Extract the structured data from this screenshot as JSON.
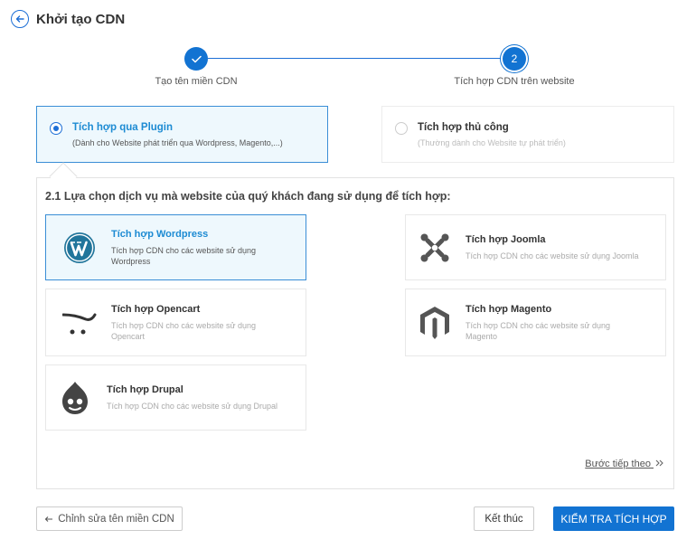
{
  "header": {
    "title": "Khởi tạo CDN"
  },
  "stepper": {
    "step1": {
      "label": "Tạo tên miền CDN",
      "icon": "check-icon"
    },
    "step2": {
      "number": "2",
      "label": "Tích hợp CDN trên website"
    }
  },
  "options": [
    {
      "title": "Tích hợp qua Plugin",
      "desc": "(Dành cho Website phát triển qua Wordpress, Magento,...)",
      "selected": true
    },
    {
      "title": "Tích hợp thủ công",
      "desc": "(Thường dành cho Website tự phát triển)",
      "selected": false
    }
  ],
  "panel": {
    "title": "2.1 Lựa chọn dịch vụ mà website của quý khách đang sử dụng để tích hợp:",
    "cards": [
      {
        "title": "Tích hợp Wordpress",
        "desc": "Tích hợp CDN cho các website sử dụng Wordpress",
        "icon": "wordpress-icon",
        "selected": true
      },
      {
        "title": "Tích hợp Joomla",
        "desc": "Tích hợp CDN cho các website sử dụng Joomla",
        "icon": "joomla-icon",
        "selected": false
      },
      {
        "title": "Tích hợp Opencart",
        "desc": "Tích hợp CDN cho các website sử dụng Opencart",
        "icon": "opencart-icon",
        "selected": false
      },
      {
        "title": "Tích hợp Magento",
        "desc": "Tích hợp CDN cho các website sử dụng Magento",
        "icon": "magento-icon",
        "selected": false
      },
      {
        "title": "Tích hợp Drupal",
        "desc": "Tích hợp CDN cho các website sử dụng Drupal",
        "icon": "drupal-icon",
        "selected": false
      }
    ],
    "next_label": "Bước tiếp theo"
  },
  "footer": {
    "edit_label": "Chỉnh sửa tên miền CDN",
    "finish_label": "Kết thúc",
    "check_label": "KIỂM TRA TÍCH HỢP"
  },
  "colors": {
    "primary": "#1273d2",
    "accent_text": "#1d8bd3",
    "selected_bg": "#eef8fd",
    "border_selected": "#3a8ed6"
  }
}
